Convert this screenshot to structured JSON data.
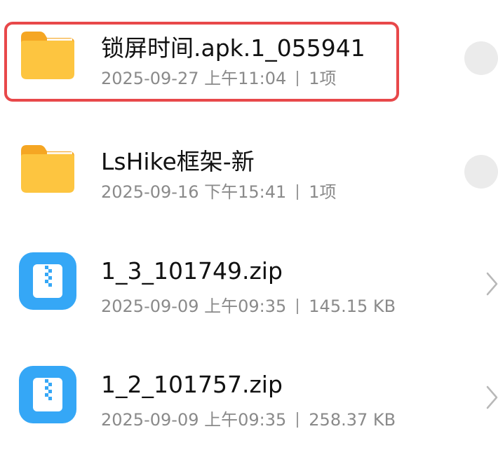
{
  "items": [
    {
      "type": "folder",
      "icon": "folder-icon",
      "name": "锁屏时间.apk.1_055941",
      "date": "2025-09-27 上午11:04",
      "info": "1项",
      "action": "select-circle"
    },
    {
      "type": "folder",
      "icon": "folder-icon",
      "name": "LsHike框架-新",
      "date": "2025-09-16 下午15:41",
      "info": "1项",
      "action": "select-circle"
    },
    {
      "type": "zip",
      "icon": "zip-file-icon",
      "name": "1_3_101749.zip",
      "date": "2025-09-09 上午09:35",
      "info": "145.15 KB",
      "action": "chevron-right"
    },
    {
      "type": "zip",
      "icon": "zip-file-icon",
      "name": "1_2_101757.zip",
      "date": "2025-09-09 上午09:35",
      "info": "258.37 KB",
      "action": "chevron-right"
    }
  ],
  "colors": {
    "folder": "#fdc540",
    "folder_tab": "#f5a623",
    "zip": "#35a7f6",
    "highlight": "#e8484a"
  }
}
